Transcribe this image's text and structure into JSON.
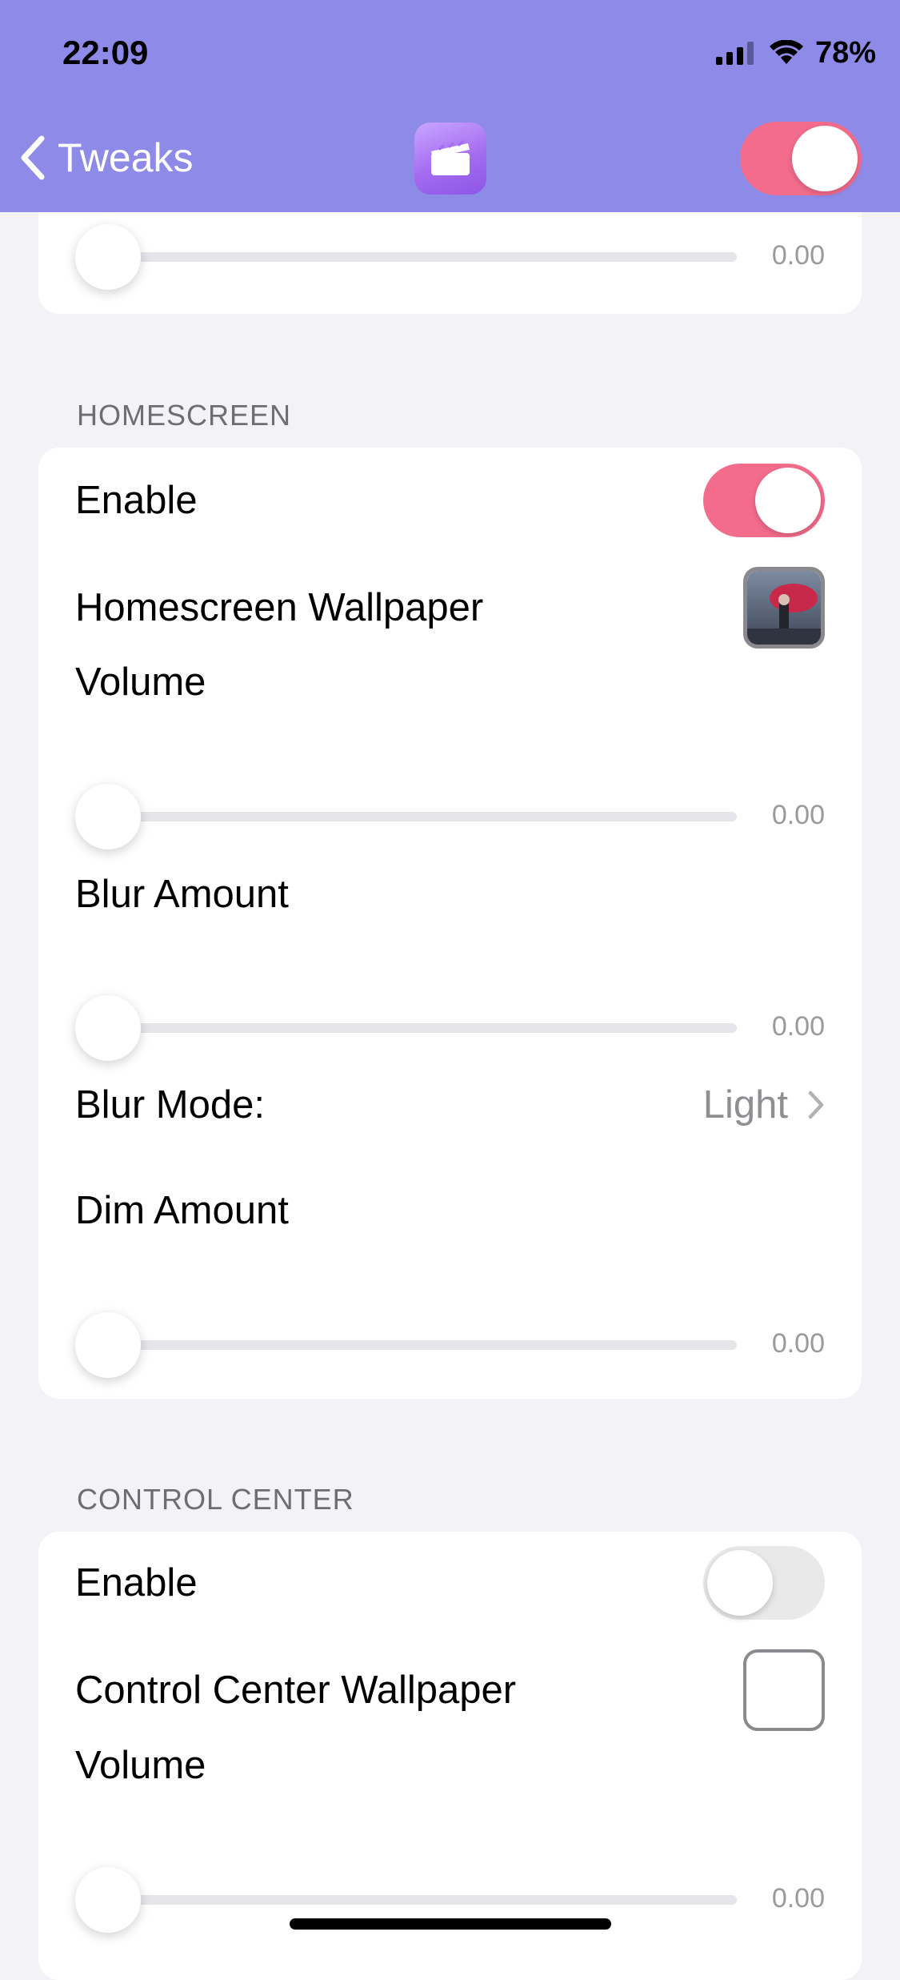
{
  "status_bar": {
    "time": "22:09",
    "battery": "78%"
  },
  "nav": {
    "back_label": "Tweaks",
    "master_toggle_on": true
  },
  "top_card": {
    "slider_value": "0.00"
  },
  "homescreen": {
    "section_title": "HOMESCREEN",
    "enable_label": "Enable",
    "enable_on": true,
    "wallpaper_label": "Homescreen Wallpaper",
    "volume_label": "Volume",
    "volume_value": "0.00",
    "blur_amount_label": "Blur Amount",
    "blur_amount_value": "0.00",
    "blur_mode_label": "Blur Mode:",
    "blur_mode_value": "Light",
    "dim_amount_label": "Dim Amount",
    "dim_amount_value": "0.00"
  },
  "control_center": {
    "section_title": "CONTROL CENTER",
    "enable_label": "Enable",
    "enable_on": false,
    "wallpaper_label": "Control Center Wallpaper",
    "volume_label": "Volume",
    "volume_value": "0.00"
  },
  "colors": {
    "header": "#8e8ae8",
    "accent": "#f46c8c",
    "background": "#f2f2f7"
  }
}
